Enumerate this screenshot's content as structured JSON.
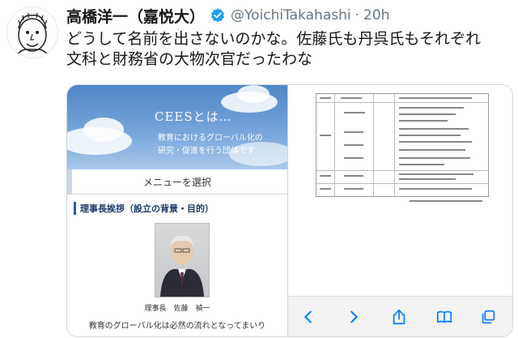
{
  "tweet": {
    "display_name": "高橋洋一（嘉悦大）",
    "handle": "@YoichiTakahashi",
    "separator": "·",
    "time": "20h",
    "text_lines": [
      "どうして名前を出さないのかな。佐藤氏も丹呉氏もそれぞれ",
      "文科と財務省の大物次官だったわな"
    ]
  },
  "media_left": {
    "cees_title": "CEESとは…",
    "cees_sub1": "教育におけるグローバル化の",
    "cees_sub2": "研究・促進を行う団体です",
    "menu_label": "メニューを選択",
    "section_title": "理事長挨拶（設立の背景・目的）",
    "photo_caption": "理事長　佐藤　禎一",
    "bottom_text": "教育のグローバル化は必然の流れとなってまいり"
  },
  "browser_icons": [
    "back-icon",
    "forward-icon",
    "share-icon",
    "bookmarks-icon",
    "tabs-icon"
  ],
  "colors": {
    "verified": "#1da1f2",
    "browser_icon": "#007aff"
  }
}
